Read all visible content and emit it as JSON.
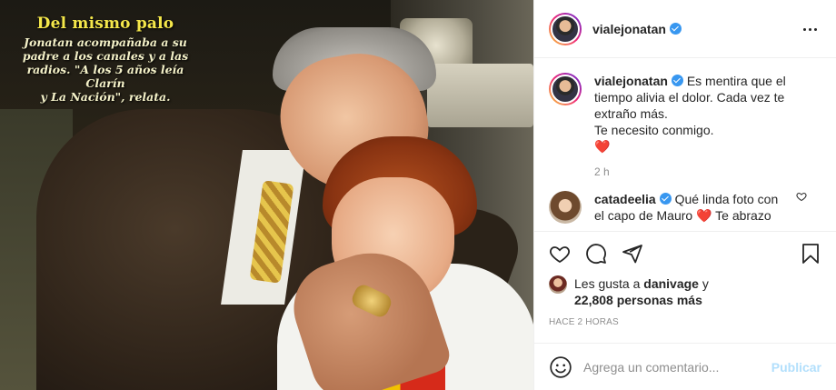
{
  "photo": {
    "caption_title": "Del mismo palo",
    "caption_lines": [
      "Jonatan acompañaba a su",
      "padre a los canales y a las",
      "radios. \"A los 5 años leía Clarín",
      "y La Nación\", relata."
    ]
  },
  "header": {
    "username": "vialejonatan",
    "verified": true
  },
  "caption": {
    "username": "vialejonatan",
    "text_lines": [
      "Es mentira que el",
      "tiempo alivia el dolor. Cada vez te",
      "extraño más.",
      "Te necesito conmigo."
    ],
    "emoji": "❤️",
    "time": "2 h"
  },
  "comments": [
    {
      "username": "catadeelia",
      "text_lines": [
        "Qué linda foto con",
        "el capo de Mauro ❤️ Te abrazo"
      ]
    }
  ],
  "likes": {
    "prefix": "Les gusta a",
    "first_user": "danivage",
    "connector": "y",
    "count_text": "22,808 personas más"
  },
  "timestamp": "HACE 2 HORAS",
  "add_comment": {
    "placeholder": "Agrega un comentario...",
    "post_label": "Publicar"
  },
  "colors": {
    "verified": "#3897f0",
    "heart": "#e0245e",
    "post_button_disabled": "#b2dffc",
    "caption_title": "#f4e74a"
  },
  "icons": [
    "more-options-icon",
    "heart-icon",
    "comment-icon",
    "share-icon",
    "bookmark-icon",
    "emoji-icon",
    "verified-badge-icon"
  ]
}
